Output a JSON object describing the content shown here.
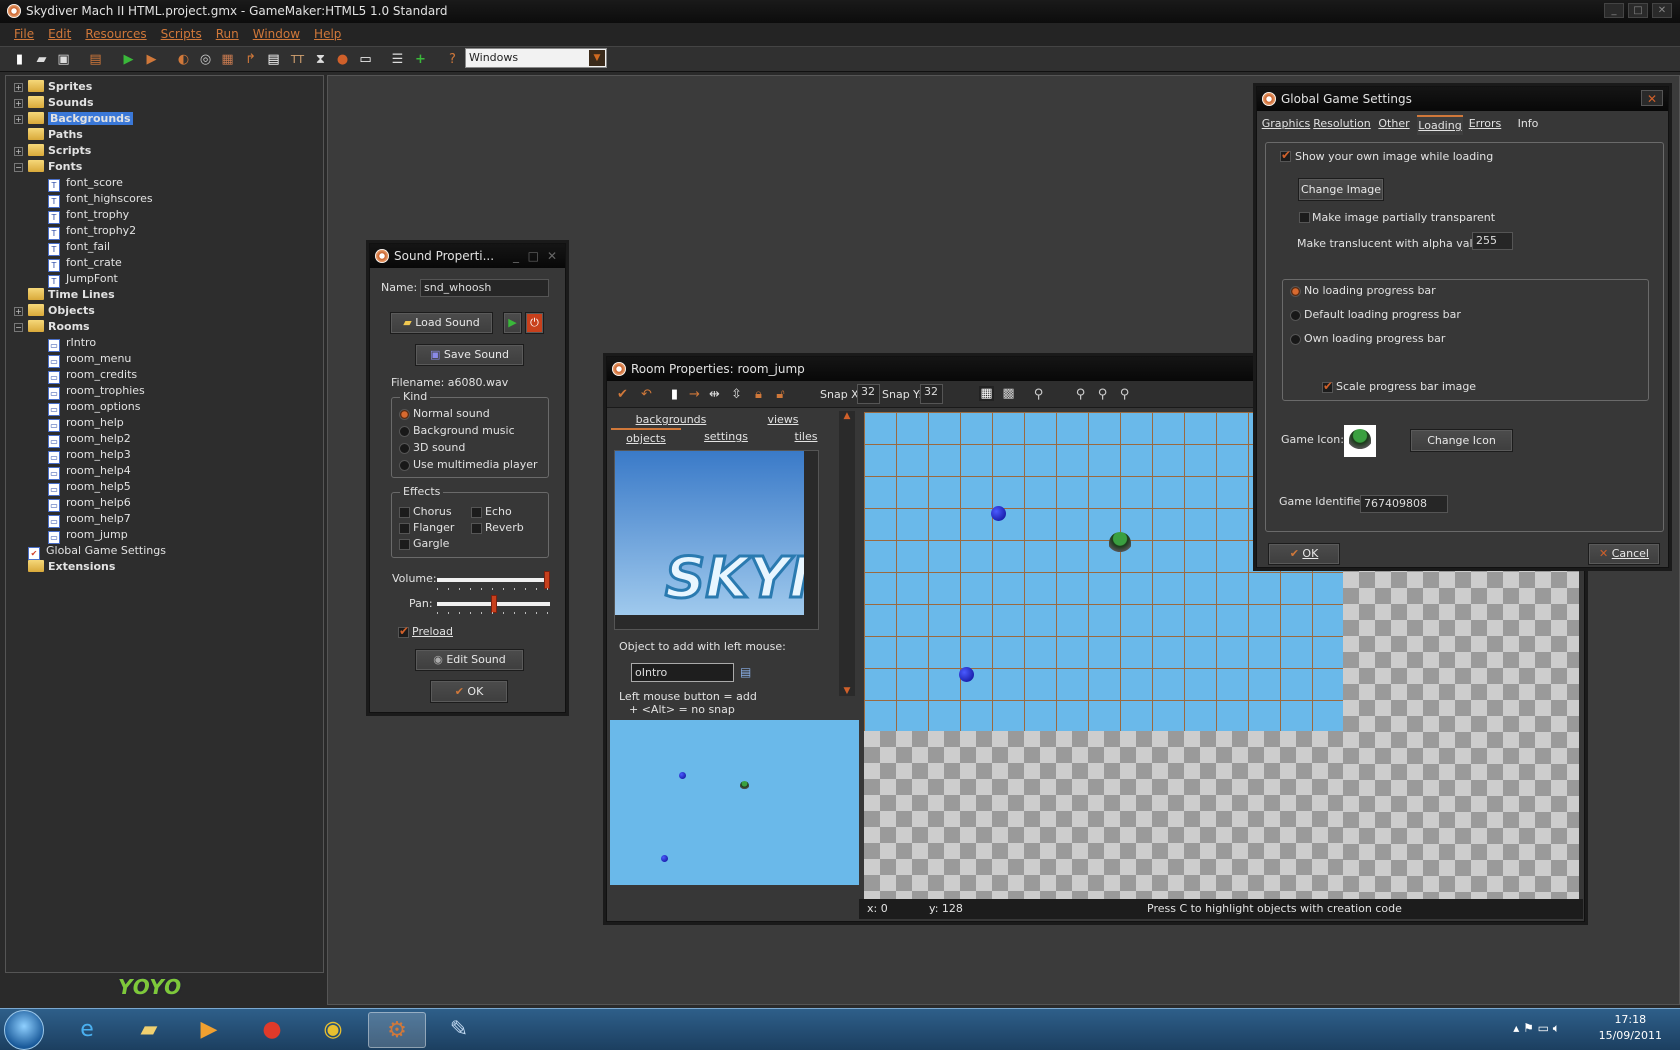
{
  "window": {
    "title": "Skydiver Mach II HTML.project.gmx - GameMaker:HTML5 1.0 Standard"
  },
  "menu": [
    "File",
    "Edit",
    "Resources",
    "Scripts",
    "Run",
    "Window",
    "Help"
  ],
  "toolbar": {
    "icons": [
      "new-icon",
      "open-icon",
      "save-icon",
      "publish-icon",
      "run-icon",
      "debug-run-icon",
      "sprite-icon",
      "sound-icon",
      "background-icon",
      "path-icon",
      "script-icon",
      "font-icon",
      "timeline-icon",
      "object-icon",
      "room-icon",
      "game-info-icon",
      "add-extension-icon",
      "help-icon"
    ],
    "target_select": "Windows"
  },
  "tree": [
    {
      "label": "Sprites",
      "level": 0,
      "type": "folder",
      "exp": "+"
    },
    {
      "label": "Sounds",
      "level": 0,
      "type": "folder",
      "exp": "+"
    },
    {
      "label": "Backgrounds",
      "level": 0,
      "type": "folder",
      "exp": "+",
      "selected": true
    },
    {
      "label": "Paths",
      "level": 0,
      "type": "folder",
      "exp": ""
    },
    {
      "label": "Scripts",
      "level": 0,
      "type": "folder",
      "exp": "+"
    },
    {
      "label": "Fonts",
      "level": 0,
      "type": "folder",
      "exp": "−"
    },
    {
      "label": "font_score",
      "level": 1,
      "type": "font"
    },
    {
      "label": "font_highscores",
      "level": 1,
      "type": "font"
    },
    {
      "label": "font_trophy",
      "level": 1,
      "type": "font"
    },
    {
      "label": "font_trophy2",
      "level": 1,
      "type": "font"
    },
    {
      "label": "font_fail",
      "level": 1,
      "type": "font"
    },
    {
      "label": "font_crate",
      "level": 1,
      "type": "font"
    },
    {
      "label": "JumpFont",
      "level": 1,
      "type": "font"
    },
    {
      "label": "Time Lines",
      "level": 0,
      "type": "folder",
      "exp": ""
    },
    {
      "label": "Objects",
      "level": 0,
      "type": "folder",
      "exp": "+"
    },
    {
      "label": "Rooms",
      "level": 0,
      "type": "folder",
      "exp": "−"
    },
    {
      "label": "rIntro",
      "level": 1,
      "type": "room"
    },
    {
      "label": "room_menu",
      "level": 1,
      "type": "room"
    },
    {
      "label": "room_credits",
      "level": 1,
      "type": "room"
    },
    {
      "label": "room_trophies",
      "level": 1,
      "type": "room"
    },
    {
      "label": "room_options",
      "level": 1,
      "type": "room"
    },
    {
      "label": "room_help",
      "level": 1,
      "type": "room"
    },
    {
      "label": "room_help2",
      "level": 1,
      "type": "room"
    },
    {
      "label": "room_help3",
      "level": 1,
      "type": "room"
    },
    {
      "label": "room_help4",
      "level": 1,
      "type": "room"
    },
    {
      "label": "room_help5",
      "level": 1,
      "type": "room"
    },
    {
      "label": "room_help6",
      "level": 1,
      "type": "room"
    },
    {
      "label": "room_help7",
      "level": 1,
      "type": "room"
    },
    {
      "label": "room_jump",
      "level": 1,
      "type": "room"
    },
    {
      "label": "Global Game Settings",
      "level": 0,
      "type": "settings"
    },
    {
      "label": "Extensions",
      "level": 0,
      "type": "folder",
      "exp": ""
    }
  ],
  "logo": "YOYO GAMES",
  "sound": {
    "title": "Sound Properti...",
    "name_label": "Name:",
    "name_value": "snd_whoosh",
    "load": "Load Sound",
    "save": "Save Sound",
    "filename": "Filename: a6080.wav",
    "kind_label": "Kind",
    "kinds": [
      "Normal sound",
      "Background music",
      "3D sound",
      "Use multimedia player"
    ],
    "kind_selected": 0,
    "effects_label": "Effects",
    "effects": [
      "Chorus",
      "Echo",
      "Flanger",
      "Reverb",
      "Gargle"
    ],
    "volume_label": "Volume:",
    "volume": 1.0,
    "pan_label": "Pan:",
    "pan": 0.5,
    "preload": "Preload",
    "preload_checked": true,
    "edit": "Edit Sound",
    "ok": "OK"
  },
  "room": {
    "title": "Room Properties: room_jump",
    "snap_x_label": "Snap X:",
    "snap_x": "32",
    "snap_y_label": "Snap Y:",
    "snap_y": "32",
    "tabs_row1": [
      "backgrounds",
      "views"
    ],
    "tabs_row2": [
      "objects",
      "settings",
      "tiles"
    ],
    "active_tab": "objects",
    "object_label": "Object to add with left mouse:",
    "object_value": "oIntro",
    "hint1": "Left mouse button = add",
    "hint2": "+ <Alt> = no snap",
    "preview_text": "SKYI",
    "status_x": "x: 0",
    "status_y": "y: 128",
    "status_hint": "Press C to highlight objects with creation code"
  },
  "ggs": {
    "title": "Global Game Settings",
    "tabs": [
      "Graphics",
      "Resolution",
      "Other",
      "Loading",
      "Errors",
      "Info"
    ],
    "active_tab": "Loading",
    "show_image": "Show your own image while loading",
    "change_image": "Change Image",
    "transparent": "Make image partially transparent",
    "alpha_label": "Make translucent with alpha value:",
    "alpha": "255",
    "progress": [
      "No loading progress bar",
      "Default loading progress bar",
      "Own loading progress bar"
    ],
    "progress_selected": 0,
    "scale": "Scale progress bar image",
    "icon_label": "Game Icon:",
    "change_icon": "Change Icon",
    "id_label": "Game Identifier:",
    "id": "767409808",
    "ok": "OK",
    "cancel": "Cancel"
  },
  "taskbar": {
    "apps": [
      "internet-explorer-icon",
      "file-explorer-icon",
      "media-player-icon",
      "red-app-icon",
      "chrome-icon",
      "gamemaker-icon",
      "paint-icon"
    ],
    "active": "gamemaker-icon",
    "time": "17:18",
    "date": "15/09/2011"
  },
  "colors": {
    "accent": "#d0783a",
    "selection": "#3a78d8",
    "room_bg": "#6ab9ea"
  }
}
